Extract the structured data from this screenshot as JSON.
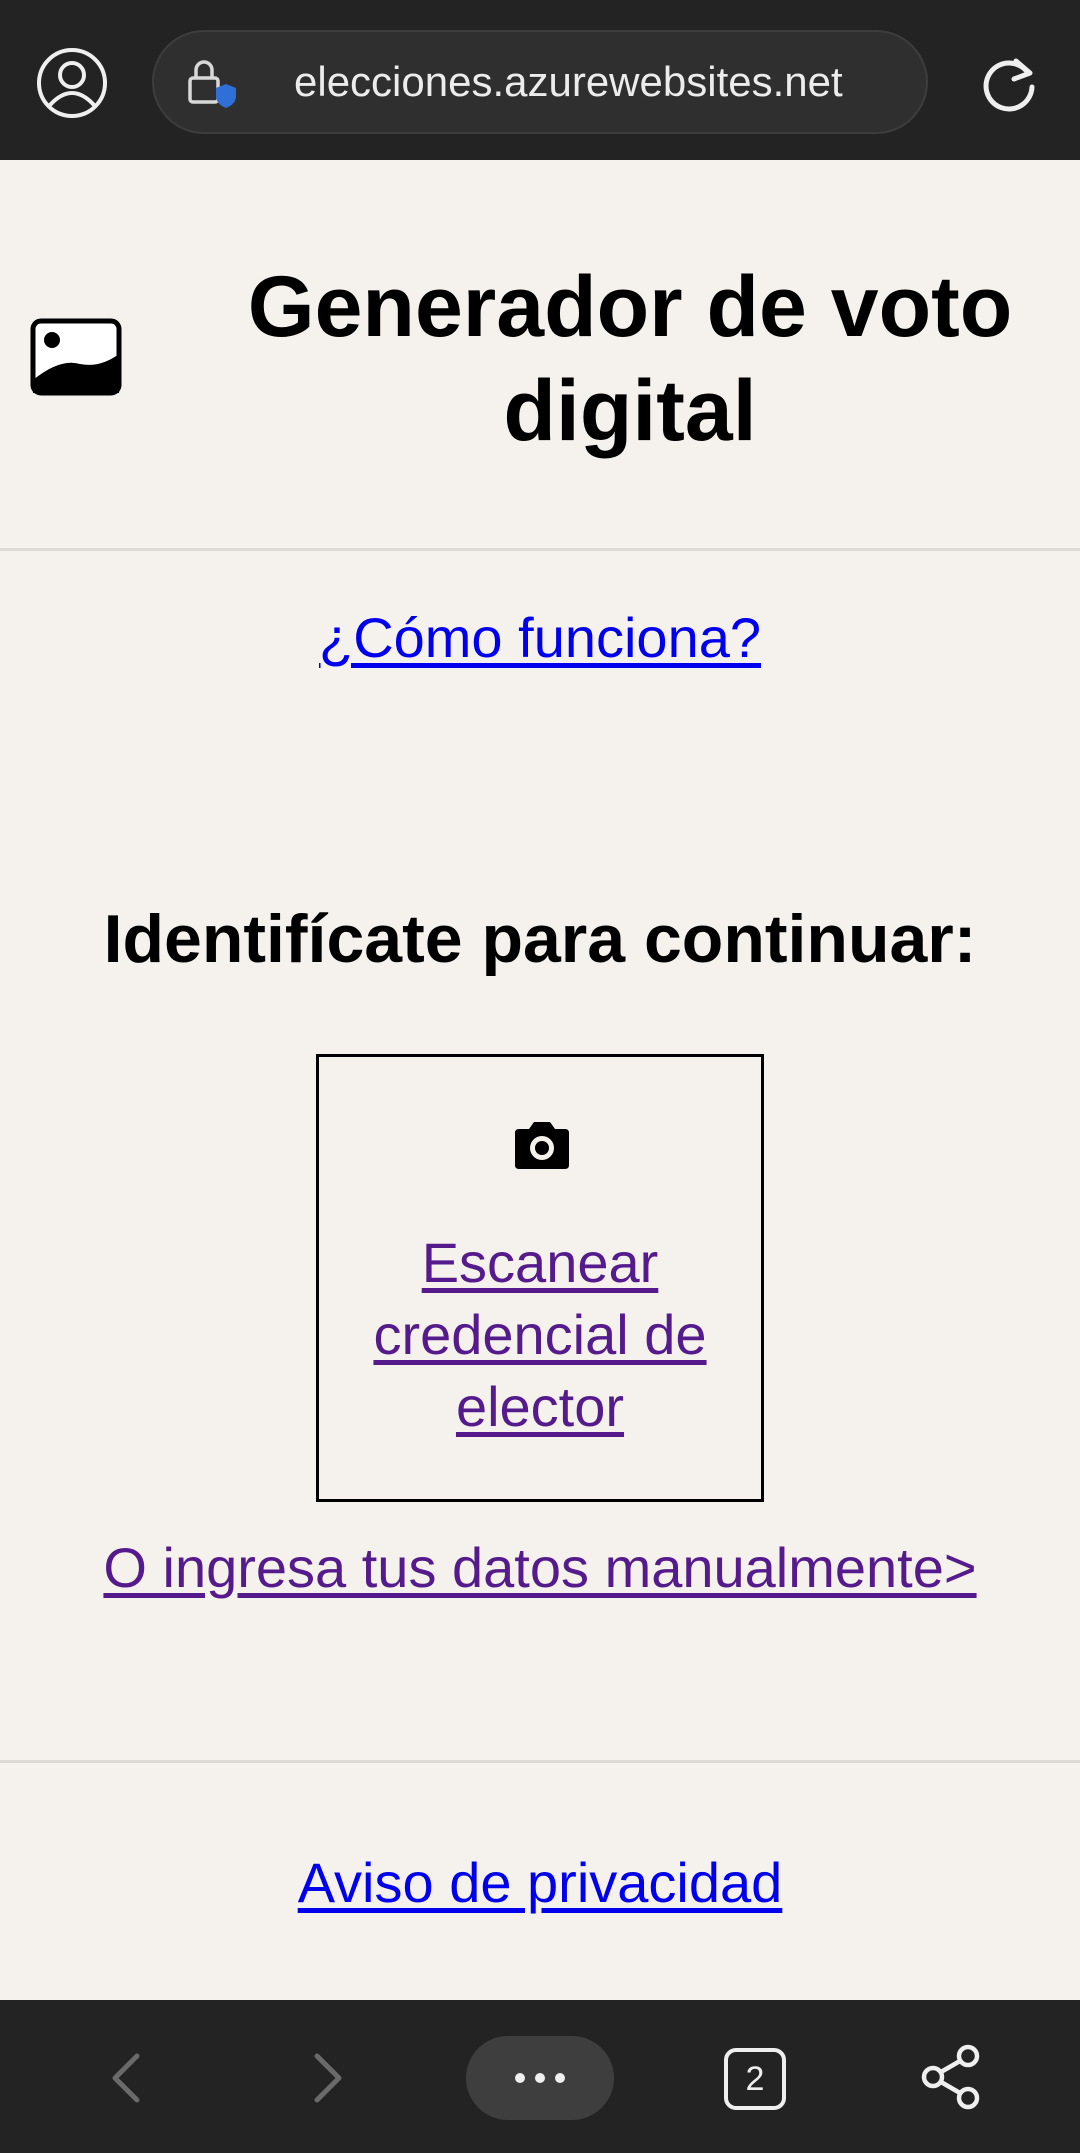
{
  "browser": {
    "url": "elecciones.azurewebsites.net",
    "tab_count": "2"
  },
  "header": {
    "title": "Generador de voto digital"
  },
  "links": {
    "how_it_works": "¿Cómo funciona?",
    "manual_entry": "O ingresa tus datos manualmente>",
    "privacy": "Aviso de privacidad"
  },
  "main": {
    "identify_heading": "Identifícate para continuar:",
    "scan_label": "Escanear credencial de elector"
  },
  "icons": {
    "broken_image": "image-placeholder-icon",
    "camera": "camera-icon",
    "lock": "lock-shield-icon",
    "profile": "profile-icon",
    "reload": "reload-icon",
    "back": "back-arrow-icon",
    "forward": "forward-arrow-icon",
    "menu": "more-dots-icon",
    "share": "share-icon"
  },
  "colors": {
    "link": "#0000ee",
    "visited_link": "#551a8b",
    "page_bg": "#f5f2ee",
    "bar_bg": "#232323"
  }
}
